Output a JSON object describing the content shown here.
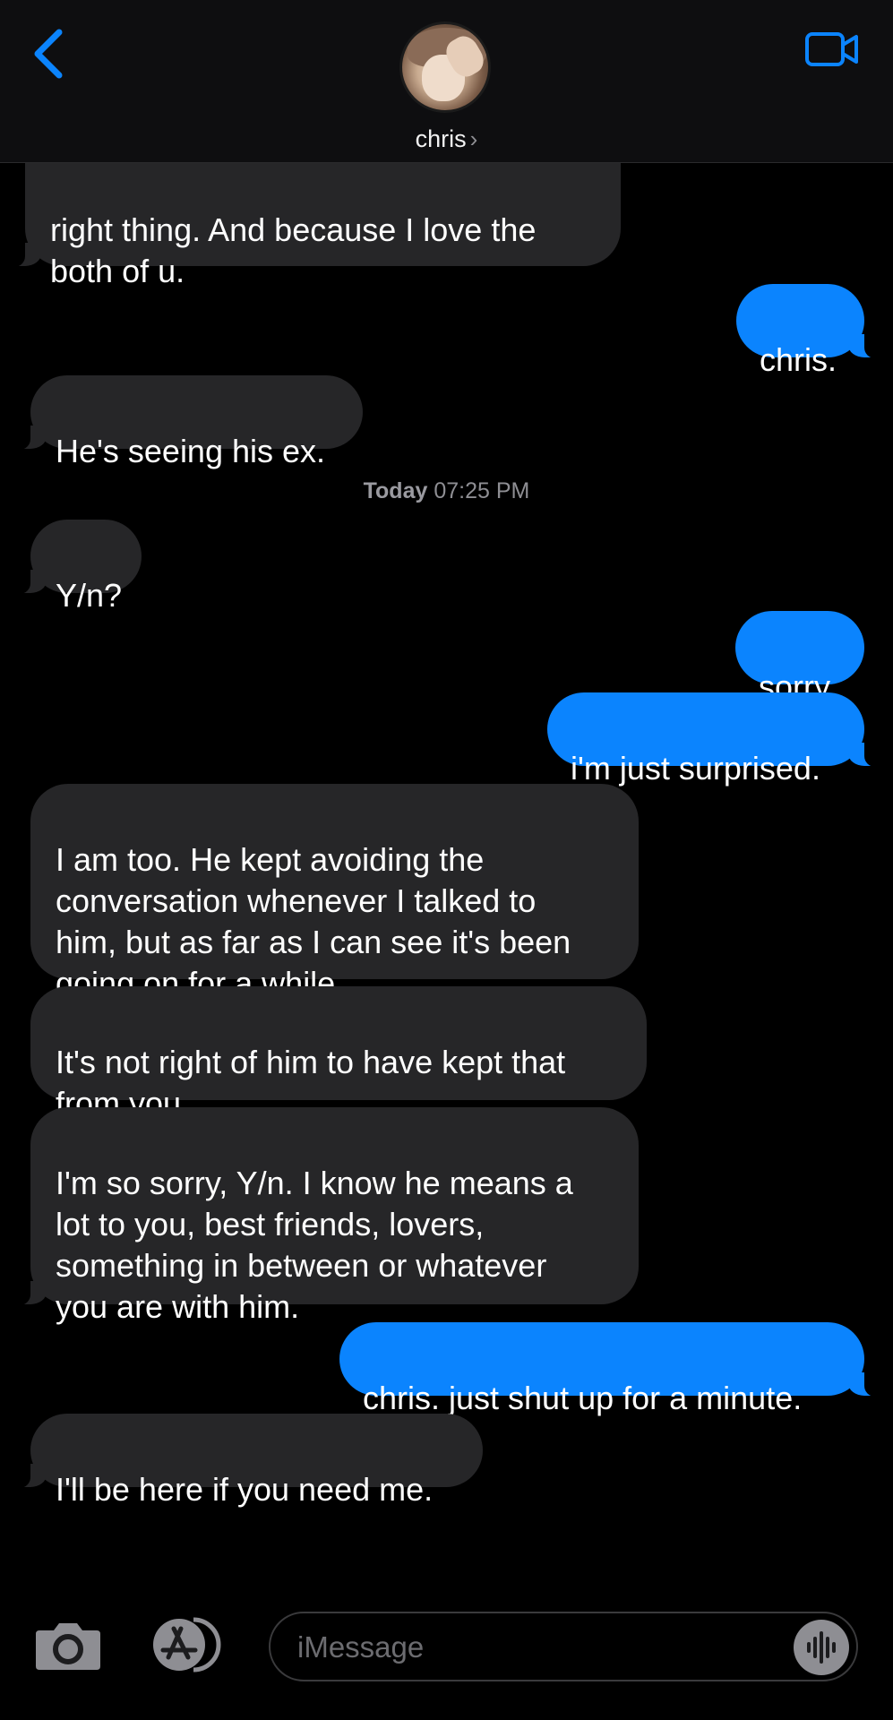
{
  "header": {
    "contact_name": "chris",
    "chevron": "›",
    "icons": {
      "back": "chevron-left-icon",
      "video": "video-camera-icon",
      "avatar": "contact-avatar"
    },
    "accent_color": "#0b84fe"
  },
  "conversation": {
    "timestamp_day": "Today",
    "timestamp_time": "07:25 PM",
    "messages": [
      {
        "from": "contact",
        "text": "right thing. And because I love the\nboth of u."
      },
      {
        "from": "me",
        "text": "chris."
      },
      {
        "from": "contact",
        "text": "He's seeing his ex."
      },
      {
        "from": "contact",
        "text": "Y/n?"
      },
      {
        "from": "me",
        "text": "sorry."
      },
      {
        "from": "me",
        "text": "i'm just surprised."
      },
      {
        "from": "contact",
        "text": "I am too. He kept avoiding the\nconversation whenever I talked to\nhim, but as far as I can see it's been\ngoing on for a while."
      },
      {
        "from": "contact",
        "text": "It's not right of him to have kept that\nfrom you."
      },
      {
        "from": "contact",
        "text": "I'm so sorry, Y/n. I know he means a\nlot to you, best friends, lovers,\nsomething in between or whatever\nyou are with him."
      },
      {
        "from": "me",
        "text": "chris. just shut up for a minute."
      },
      {
        "from": "contact",
        "text": "I'll be here if you need me."
      }
    ]
  },
  "composer": {
    "placeholder": "iMessage",
    "icons": {
      "camera": "camera-icon",
      "apps": "app-store-icon",
      "audio": "audio-waveform-icon"
    }
  }
}
